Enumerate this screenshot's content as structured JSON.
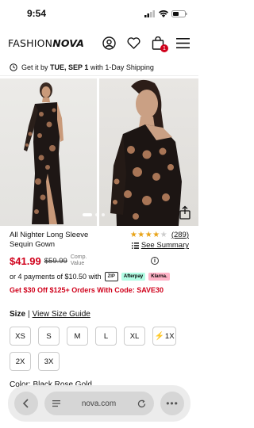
{
  "status": {
    "time": "9:54"
  },
  "header": {
    "logo_thin": "FASHION",
    "logo_bold": "NOVA",
    "cart_count": "1"
  },
  "shipping": {
    "prefix": "Get it by ",
    "date": "TUE, SEP 1",
    "suffix": " with 1-Day Shipping"
  },
  "gallery": {
    "active_index": 0,
    "count": 3
  },
  "product": {
    "name": "All Nighter Long Sleeve Sequin Gown",
    "rating": 4.5,
    "rating_count": "(289)",
    "see_summary": "See Summary",
    "price": "$41.99",
    "old_price": "$59.99",
    "comp_line1": "Comp.",
    "comp_line2": "Value",
    "installments": "or 4 payments of $10.50 with",
    "pay_zip": "ZIP",
    "pay_afterpay": "Afterpay",
    "pay_klarna": "Klarna.",
    "promo": "Get $30 Off $125+ Orders With Code: SAVE30"
  },
  "size": {
    "label": "Size",
    "separator": "|",
    "guide": "View Size Guide",
    "options": [
      "XS",
      "S",
      "M",
      "L",
      "XL",
      "1X",
      "2X",
      "3X"
    ]
  },
  "color": {
    "label": "Color: Black Rose Gold"
  },
  "browser": {
    "url": "nova.com",
    "more": "•••"
  },
  "colors": {
    "accent": "#d0011b",
    "star": "#e8a317"
  }
}
